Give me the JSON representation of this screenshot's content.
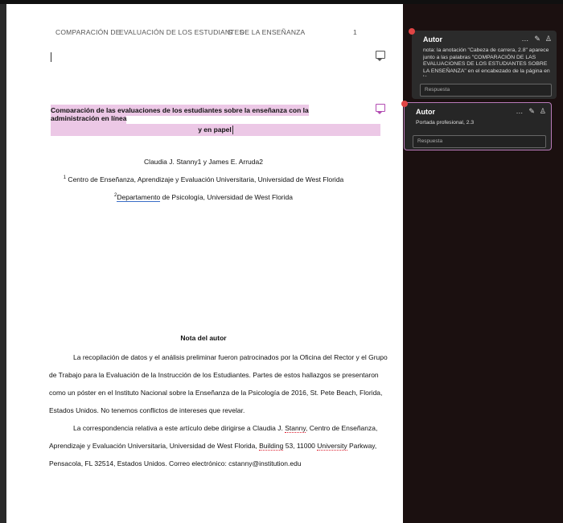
{
  "header": {
    "part1": "COMPARACIÓN DE",
    "part2": "EVALUACIÓN DE LOS ESTUDIANTES",
    "part3": "S",
    "part4": "DE LA ENSEÑANZA",
    "page_number": "1"
  },
  "document": {
    "title_line1": "Comparación de las evaluaciones de los estudiantes sobre la enseñanza con la administración en línea",
    "title_line2": "y en papel",
    "authors": "Claudia J. Stanny1 y James E. Arruda2",
    "affiliation1_sup": "1",
    "affiliation1": " Centro de Enseñanza, Aprendizaje y Evaluación Universitaria, Universidad de West Florida",
    "affiliation2_sup": "2",
    "affiliation2_word": "Departamento",
    "affiliation2_rest": " de Psicología, Universidad de West Florida",
    "note_heading": "Nota del autor",
    "note_para1": "La recopilación de datos y el análisis preliminar fueron patrocinados por la Oficina del Rector y el Grupo de Trabajo para la Evaluación de la Instrucción de los Estudiantes. Partes de estos hallazgos se presentaron como un póster en el Instituto Nacional sobre la Enseñanza de la Psicología de 2016, St. Pete Beach, Florida, Estados Unidos. No tenemos conflictos de intereses que revelar.",
    "note_para2_a": "La correspondencia relativa a este artículo debe dirigirse a Claudia J. ",
    "note_para2_stanny": "Stanny",
    "note_para2_b": ", Centro de Enseñanza, Aprendizaje y Evaluación Universitaria, Universidad de West Florida, ",
    "note_para2_building": "Building",
    "note_para2_c": " 53, 11000 ",
    "note_para2_university": "University",
    "note_para2_d": " Parkway, Pensacola, FL 32514, Estados Unidos. Correo electrónico: cstanny@institution.edu"
  },
  "comments": [
    {
      "author": "Autor",
      "text": "nota: la anotación \"Cabeza de carrera, 2.8\" aparece junto a las palabras \"COMPARACIÓN DE LAS EVALUACIONES DE LOS ESTUDIANTES SOBRE LA ENSEÑANZA\" en el encabezado de la página en la",
      "reply_placeholder": "Respuesta"
    },
    {
      "author": "Autor",
      "text": "Portada profesional, 2.3",
      "reply_placeholder": "Respuesta"
    }
  ],
  "icons": {
    "more": "…",
    "edit": "✎",
    "resolve": "♙"
  },
  "colors": {
    "highlight": "#ecc8e6",
    "active_comment_border": "#b97ab9",
    "badge": "#e04545"
  }
}
